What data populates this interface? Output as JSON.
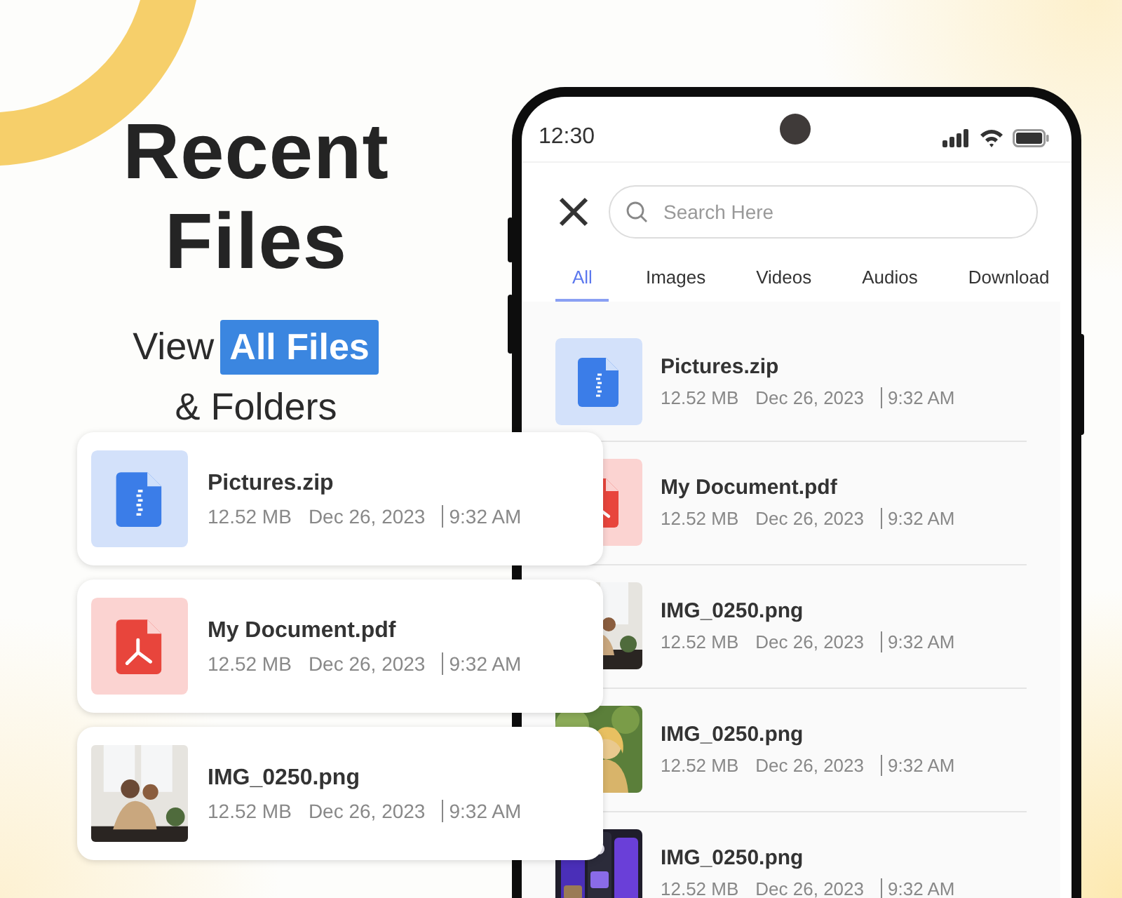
{
  "headline": {
    "title": "Recent Files",
    "lead": "View",
    "highlight": "All Files",
    "tail": "& Folders"
  },
  "phone": {
    "status_time": "12:30",
    "search": {
      "placeholder": "Search Here"
    },
    "tabs": [
      {
        "label": "All",
        "selected": true
      },
      {
        "label": "Images",
        "selected": false
      },
      {
        "label": "Videos",
        "selected": false
      },
      {
        "label": "Audios",
        "selected": false
      },
      {
        "label": "Download",
        "selected": false
      }
    ],
    "files": [
      {
        "kind": "zip",
        "name": "Pictures.zip",
        "size": "12.52 MB",
        "date": "Dec 26, 2023",
        "time": "9:32 AM"
      },
      {
        "kind": "pdf",
        "name": "My Document.pdf",
        "size": "12.52 MB",
        "date": "Dec 26, 2023",
        "time": "9:32 AM"
      },
      {
        "kind": "picture",
        "name": "IMG_0250.png",
        "size": "12.52 MB",
        "date": "Dec 26, 2023",
        "time": "9:32 AM"
      },
      {
        "kind": "picture",
        "name": "IMG_0250.png",
        "size": "12.52 MB",
        "date": "Dec 26, 2023",
        "time": "9:32 AM"
      },
      {
        "kind": "picture",
        "name": "IMG_0250.png",
        "size": "12.52 MB",
        "date": "Dec 26, 2023",
        "time": "9:32 AM"
      }
    ]
  },
  "cards": [
    {
      "kind": "zip",
      "name": "Pictures.zip",
      "size": "12.52 MB",
      "date": "Dec 26, 2023",
      "time": "9:32 AM"
    },
    {
      "kind": "pdf",
      "name": "My Document.pdf",
      "size": "12.52 MB",
      "date": "Dec 26, 2023",
      "time": "9:32 AM"
    },
    {
      "kind": "picture",
      "name": "IMG_0250.png",
      "size": "12.52 MB",
      "date": "Dec 26, 2023",
      "time": "9:32 AM"
    }
  ]
}
